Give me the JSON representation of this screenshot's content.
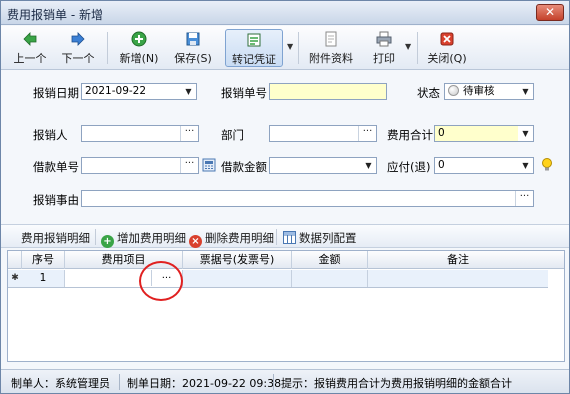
{
  "window": {
    "title": "费用报销单 - 新增",
    "close": "✕"
  },
  "toolbar": {
    "prev": "上一个",
    "next": "下一个",
    "add": "新增(N)",
    "save": "保存(S)",
    "post": "转记凭证",
    "attach": "附件资料",
    "print": "打印",
    "close": "关闭(Q)"
  },
  "form": {
    "date_label": "报销日期",
    "date_value": "2021-09-22",
    "docno_label": "报销单号",
    "docno_value": "",
    "status_label": "状态",
    "status_value": "待审核",
    "person_label": "报销人",
    "person_value": "",
    "dept_label": "部门",
    "dept_value": "",
    "total_label": "费用合计",
    "total_value": "0",
    "loan_no_label": "借款单号",
    "loan_no_value": "",
    "loan_amount_label": "借款金额",
    "loan_amount_value": "",
    "payable_label": "应付(退)",
    "payable_value": "0",
    "reason_label": "报销事由",
    "reason_value": "",
    "ellipsis": "···"
  },
  "detail_toolbar": {
    "title": "费用报销明细",
    "add": "增加费用明细",
    "delete": "删除费用明细",
    "columns": "数据列配置"
  },
  "grid": {
    "columns": [
      "序号",
      "费用项目",
      "票据号(发票号)",
      "金额",
      "备注"
    ],
    "rows": [
      {
        "index": "1",
        "item": "",
        "invoice": "",
        "amount": "",
        "note": ""
      }
    ],
    "row_indicator": "✱",
    "ellipsis": "···"
  },
  "statusbar": {
    "maker": "制单人：系统管理员",
    "make_date": "制单日期：2021-09-22 09:38",
    "hint": "提示：报销费用合计为费用报销明细的金额合计"
  },
  "colors": {
    "accent": "#7fa3d1",
    "required_field": "#ffffcc",
    "annotation": "#e02020"
  }
}
